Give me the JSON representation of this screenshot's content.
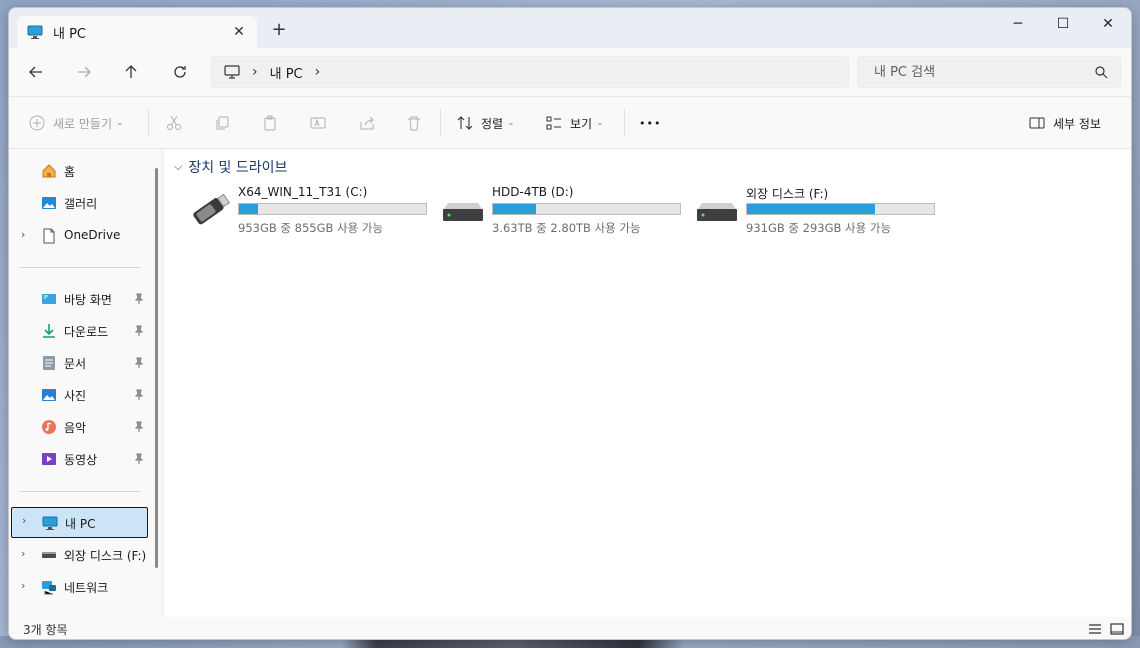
{
  "titlebar": {
    "tab_title": "내 PC",
    "close_tab": "✕",
    "new_tab": "+",
    "minimize": "─",
    "maximize": "☐",
    "close": "✕"
  },
  "address": {
    "crumbs": [
      "내 PC"
    ],
    "sep": "›",
    "search_placeholder": "내 PC 검색"
  },
  "commands": {
    "new": "새로 만들기",
    "sort": "정렬",
    "view": "보기",
    "more": "•••",
    "details": "세부 정보"
  },
  "sidebar": {
    "home": "홈",
    "gallery": "갤러리",
    "onedrive": "OneDrive",
    "pinned": [
      {
        "label": "바탕 화면",
        "icon": "desktop-icon"
      },
      {
        "label": "다운로드",
        "icon": "download-icon"
      },
      {
        "label": "문서",
        "icon": "documents-icon"
      },
      {
        "label": "사진",
        "icon": "pictures-icon"
      },
      {
        "label": "음악",
        "icon": "music-icon"
      },
      {
        "label": "동영상",
        "icon": "videos-icon"
      }
    ],
    "this_pc": "내 PC",
    "external": "외장 디스크 (F:)",
    "network": "네트워크",
    "chevron": "›"
  },
  "content": {
    "group_title": "장치 및 드라이브",
    "drives": [
      {
        "name": "X64_WIN_11_T31 (C:)",
        "free": "953GB 중 855GB 사용 가능",
        "used_fraction": 0.1,
        "icon": "usb-drive-icon"
      },
      {
        "name": "HDD-4TB (D:)",
        "free": "3.63TB 중 2.80TB 사용 가능",
        "used_fraction": 0.23,
        "icon": "hard-drive-icon"
      },
      {
        "name": "외장 디스크 (F:)",
        "free": "931GB 중 293GB 사용 가능",
        "used_fraction": 0.685,
        "icon": "hard-drive-icon"
      }
    ]
  },
  "status": {
    "count": "3개 항목"
  },
  "colors": {
    "accent": "#26a0da",
    "selection": "#cce4f7"
  }
}
